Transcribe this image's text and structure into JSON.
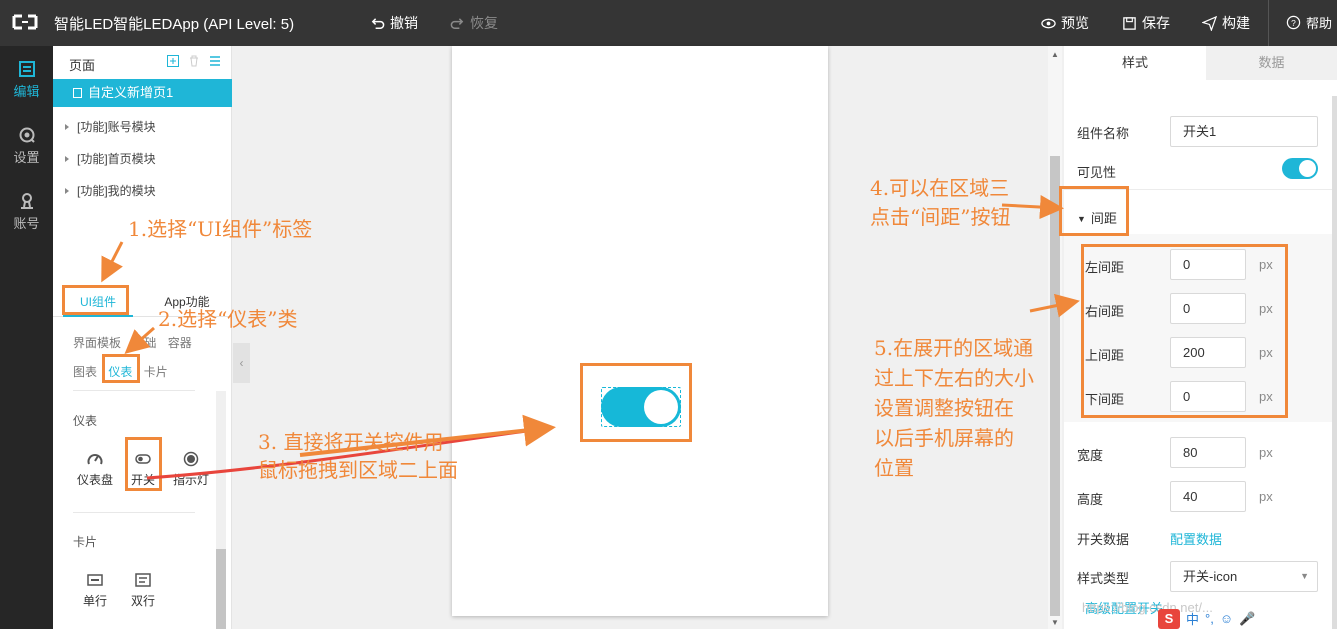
{
  "topbar": {
    "title": "智能LED智能LEDApp (API Level: 5)",
    "undo": "撤销",
    "redo": "恢复",
    "preview": "预览",
    "save": "保存",
    "build": "构建",
    "help": "帮助"
  },
  "rail": {
    "items": [
      {
        "label": "编辑",
        "icon": "edit-icon",
        "active": true
      },
      {
        "label": "设置",
        "icon": "settings-icon",
        "active": false
      },
      {
        "label": "账号",
        "icon": "account-icon",
        "active": false
      }
    ]
  },
  "pages": {
    "header": "页面",
    "active_page": "自定义新增页1",
    "modules": [
      "[功能]账号模块",
      "[功能]首页模块",
      "[功能]我的模块"
    ]
  },
  "components": {
    "tabs": [
      "UI组件",
      "App功能"
    ],
    "categories_row1": [
      "界面模板",
      "基础",
      "容器"
    ],
    "categories_row2": [
      "图表",
      "仪表",
      "卡片"
    ],
    "section_meter": "仪表",
    "meter_items": [
      "仪表盘",
      "开关",
      "指示灯"
    ],
    "section_card": "卡片",
    "card_items": [
      "单行",
      "双行"
    ]
  },
  "props": {
    "tabs": [
      "样式",
      "数据"
    ],
    "name_label": "组件名称",
    "name_value": "开关1",
    "visible_label": "可见性",
    "visible_on": true,
    "spacing_header": "间距",
    "left_label": "左间距",
    "left_value": "0",
    "right_label": "右间距",
    "right_value": "0",
    "top_label": "上间距",
    "top_value": "200",
    "bottom_label": "下间距",
    "bottom_value": "0",
    "unit": "px",
    "width_label": "宽度",
    "width_value": "80",
    "height_label": "高度",
    "height_value": "40",
    "switch_data_label": "开关数据",
    "config_link": "配置数据",
    "style_type_label": "样式类型",
    "style_type_value": "开关-icon",
    "advanced_link": "高级配置开关"
  },
  "annotations": {
    "a1": "1.选择“UI组件”标签",
    "a2": "2.选择“仪表”类",
    "a3_line1": "3. 直接将开关控件用",
    "a3_line2": "鼠标拖拽到区域二上面",
    "a4_line1": "4.可以在区域三",
    "a4_line2": "点击“间距”按钮",
    "a5_line1": "5.在展开的区域通",
    "a5_line2": "过上下左右的大小",
    "a5_line3": "设置调整按钮在",
    "a5_line4": "以后手机屏幕的",
    "a5_line5": "位置"
  },
  "watermark": "https://blog.csdn.net/...",
  "tray": [
    "中",
    "°,",
    "☺",
    "🎤"
  ],
  "colors": {
    "accent": "#1fb6d7",
    "annotation": "#f0883a",
    "topbar": "#353535",
    "rail": "#262626"
  }
}
